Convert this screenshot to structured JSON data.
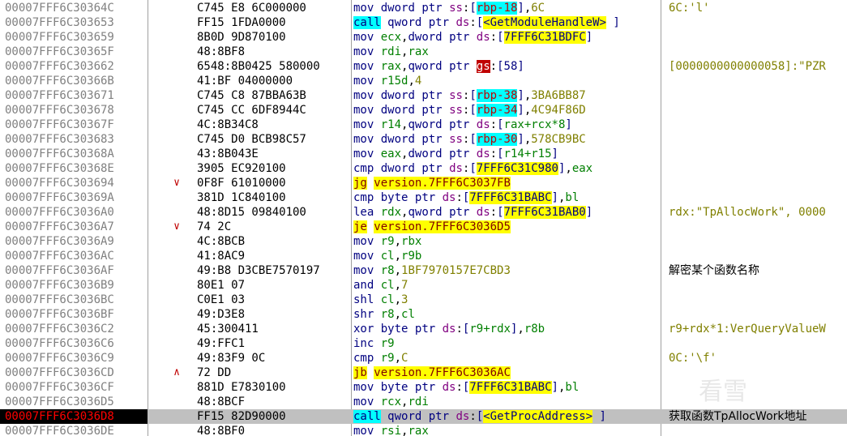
{
  "rows": [
    {
      "addr": "00007FFF6C30364C",
      "arrow": "",
      "bytes": "C745 E8 6C000000",
      "tokens": [
        [
          "mov",
          "mn"
        ],
        [
          " ",
          ""
        ],
        [
          "dword",
          "kw"
        ],
        [
          " ",
          ""
        ],
        [
          "ptr",
          "kw"
        ],
        [
          " ",
          ""
        ],
        [
          "ss",
          "seg"
        ],
        [
          ":",
          ""
        ],
        [
          "[",
          "plain"
        ],
        [
          "rbp-18",
          "rbp"
        ],
        [
          "]",
          "plain"
        ],
        [
          ",",
          ""
        ],
        [
          "6C",
          "num"
        ]
      ],
      "comment": "6C:'l'",
      "ctype": "gray"
    },
    {
      "addr": "00007FFF6C303653",
      "arrow": "",
      "bytes": "FF15 1FDA0000",
      "tokens": [
        [
          "call",
          "call"
        ],
        [
          " ",
          ""
        ],
        [
          "qword",
          "kw"
        ],
        [
          " ",
          ""
        ],
        [
          "ptr",
          "kw"
        ],
        [
          " ",
          ""
        ],
        [
          "ds",
          "seg"
        ],
        [
          ":",
          ""
        ],
        [
          "[",
          "plain"
        ],
        [
          "<GetModuleHandleW>",
          "mem"
        ],
        [
          " ]",
          "plain"
        ]
      ],
      "comment": "",
      "ctype": ""
    },
    {
      "addr": "00007FFF6C303659",
      "arrow": "",
      "bytes": "8B0D 9D870100",
      "tokens": [
        [
          "mov",
          "mn"
        ],
        [
          " ",
          ""
        ],
        [
          "ecx",
          "reg"
        ],
        [
          ",",
          ""
        ],
        [
          "dword",
          "kw"
        ],
        [
          " ",
          ""
        ],
        [
          "ptr",
          "kw"
        ],
        [
          " ",
          ""
        ],
        [
          "ds",
          "seg"
        ],
        [
          ":",
          ""
        ],
        [
          "[",
          "plain"
        ],
        [
          "7FFF6C31BDFC",
          "mem"
        ],
        [
          "]",
          "plain"
        ]
      ],
      "comment": "",
      "ctype": ""
    },
    {
      "addr": "00007FFF6C30365F",
      "arrow": "",
      "bytes": "48:8BF8",
      "tokens": [
        [
          "mov",
          "mn"
        ],
        [
          " ",
          ""
        ],
        [
          "rdi",
          "reg"
        ],
        [
          ",",
          ""
        ],
        [
          "rax",
          "reg"
        ]
      ],
      "comment": "",
      "ctype": ""
    },
    {
      "addr": "00007FFF6C303662",
      "arrow": "",
      "bytes": "6548:8B0425 580000",
      "tokens": [
        [
          "mov",
          "mn"
        ],
        [
          " ",
          ""
        ],
        [
          "rax",
          "reg"
        ],
        [
          ",",
          ""
        ],
        [
          "qword",
          "kw"
        ],
        [
          " ",
          ""
        ],
        [
          "ptr",
          "kw"
        ],
        [
          " ",
          ""
        ],
        [
          "gs",
          "gs"
        ],
        [
          ":",
          ""
        ],
        [
          "[58]",
          "plain"
        ]
      ],
      "comment": "[0000000000000058]:\"PZR",
      "ctype": "gray"
    },
    {
      "addr": "00007FFF6C30366B",
      "arrow": "",
      "bytes": "41:BF 04000000",
      "tokens": [
        [
          "mov",
          "mn"
        ],
        [
          " ",
          ""
        ],
        [
          "r15d",
          "reg"
        ],
        [
          ",",
          ""
        ],
        [
          "4",
          "num"
        ]
      ],
      "comment": "",
      "ctype": ""
    },
    {
      "addr": "00007FFF6C303671",
      "arrow": "",
      "bytes": "C745 C8 87BBA63B",
      "tokens": [
        [
          "mov",
          "mn"
        ],
        [
          " ",
          ""
        ],
        [
          "dword",
          "kw"
        ],
        [
          " ",
          ""
        ],
        [
          "ptr",
          "kw"
        ],
        [
          " ",
          ""
        ],
        [
          "ss",
          "seg"
        ],
        [
          ":",
          ""
        ],
        [
          "[",
          "plain"
        ],
        [
          "rbp-38",
          "rbp"
        ],
        [
          "]",
          "plain"
        ],
        [
          ",",
          ""
        ],
        [
          "3BA6BB87",
          "num"
        ]
      ],
      "comment": "",
      "ctype": ""
    },
    {
      "addr": "00007FFF6C303678",
      "arrow": "",
      "bytes": "C745 CC 6DF8944C",
      "tokens": [
        [
          "mov",
          "mn"
        ],
        [
          " ",
          ""
        ],
        [
          "dword",
          "kw"
        ],
        [
          " ",
          ""
        ],
        [
          "ptr",
          "kw"
        ],
        [
          " ",
          ""
        ],
        [
          "ss",
          "seg"
        ],
        [
          ":",
          ""
        ],
        [
          "[",
          "plain"
        ],
        [
          "rbp-34",
          "rbp"
        ],
        [
          "]",
          "plain"
        ],
        [
          ",",
          ""
        ],
        [
          "4C94F86D",
          "num"
        ]
      ],
      "comment": "",
      "ctype": ""
    },
    {
      "addr": "00007FFF6C30367F",
      "arrow": "",
      "bytes": "4C:8B34C8",
      "tokens": [
        [
          "mov",
          "mn"
        ],
        [
          " ",
          ""
        ],
        [
          "r14",
          "reg"
        ],
        [
          ",",
          ""
        ],
        [
          "qword",
          "kw"
        ],
        [
          " ",
          ""
        ],
        [
          "ptr",
          "kw"
        ],
        [
          " ",
          ""
        ],
        [
          "ds",
          "seg"
        ],
        [
          ":",
          ""
        ],
        [
          "[",
          "plain"
        ],
        [
          "rax+rcx*8",
          "reg"
        ],
        [
          "]",
          "plain"
        ]
      ],
      "comment": "",
      "ctype": ""
    },
    {
      "addr": "00007FFF6C303683",
      "arrow": "",
      "bytes": "C745 D0 BCB98C57",
      "tokens": [
        [
          "mov",
          "mn"
        ],
        [
          " ",
          ""
        ],
        [
          "dword",
          "kw"
        ],
        [
          " ",
          ""
        ],
        [
          "ptr",
          "kw"
        ],
        [
          " ",
          ""
        ],
        [
          "ss",
          "seg"
        ],
        [
          ":",
          ""
        ],
        [
          "[",
          "plain"
        ],
        [
          "rbp-30",
          "rbp"
        ],
        [
          "]",
          "plain"
        ],
        [
          ",",
          ""
        ],
        [
          "578CB9BC",
          "num"
        ]
      ],
      "comment": "",
      "ctype": ""
    },
    {
      "addr": "00007FFF6C30368A",
      "arrow": "",
      "bytes": "43:8B043E",
      "tokens": [
        [
          "mov",
          "mn"
        ],
        [
          " ",
          ""
        ],
        [
          "eax",
          "reg"
        ],
        [
          ",",
          ""
        ],
        [
          "dword",
          "kw"
        ],
        [
          " ",
          ""
        ],
        [
          "ptr",
          "kw"
        ],
        [
          " ",
          ""
        ],
        [
          "ds",
          "seg"
        ],
        [
          ":",
          ""
        ],
        [
          "[",
          "plain"
        ],
        [
          "r14+r15",
          "reg"
        ],
        [
          "]",
          "plain"
        ]
      ],
      "comment": "",
      "ctype": ""
    },
    {
      "addr": "00007FFF6C30368E",
      "arrow": "",
      "bytes": "3905 EC920100",
      "tokens": [
        [
          "cmp",
          "mn"
        ],
        [
          " ",
          ""
        ],
        [
          "dword",
          "kw"
        ],
        [
          " ",
          ""
        ],
        [
          "ptr",
          "kw"
        ],
        [
          " ",
          ""
        ],
        [
          "ds",
          "seg"
        ],
        [
          ":",
          ""
        ],
        [
          "[",
          "plain"
        ],
        [
          "7FFF6C31C980",
          "mem"
        ],
        [
          "]",
          "plain"
        ],
        [
          ",",
          ""
        ],
        [
          "eax",
          "reg"
        ]
      ],
      "comment": "",
      "ctype": ""
    },
    {
      "addr": "00007FFF6C303694",
      "arrow": "down",
      "bytes": "0F8F 61010000",
      "tokens": [
        [
          "jg",
          "jmp"
        ],
        [
          " ",
          ""
        ],
        [
          "version.7FFF6C3037FB",
          "jmp"
        ]
      ],
      "comment": "",
      "ctype": ""
    },
    {
      "addr": "00007FFF6C30369A",
      "arrow": "",
      "bytes": "381D 1C840100",
      "tokens": [
        [
          "cmp",
          "mn"
        ],
        [
          " ",
          ""
        ],
        [
          "byte",
          "kw"
        ],
        [
          " ",
          ""
        ],
        [
          "ptr",
          "kw"
        ],
        [
          " ",
          ""
        ],
        [
          "ds",
          "seg"
        ],
        [
          ":",
          ""
        ],
        [
          "[",
          "plain"
        ],
        [
          "7FFF6C31BABC",
          "mem"
        ],
        [
          "]",
          "plain"
        ],
        [
          ",",
          ""
        ],
        [
          "bl",
          "reg"
        ]
      ],
      "comment": "",
      "ctype": ""
    },
    {
      "addr": "00007FFF6C3036A0",
      "arrow": "",
      "bytes": "48:8D15 09840100",
      "tokens": [
        [
          "lea",
          "mn"
        ],
        [
          " ",
          ""
        ],
        [
          "rdx",
          "reg"
        ],
        [
          ",",
          ""
        ],
        [
          "qword",
          "kw"
        ],
        [
          " ",
          ""
        ],
        [
          "ptr",
          "kw"
        ],
        [
          " ",
          ""
        ],
        [
          "ds",
          "seg"
        ],
        [
          ":",
          ""
        ],
        [
          "[",
          "plain"
        ],
        [
          "7FFF6C31BAB0",
          "mem"
        ],
        [
          "]",
          "plain"
        ]
      ],
      "comment": "rdx:\"TpAllocWork\", 0000",
      "ctype": "gray"
    },
    {
      "addr": "00007FFF6C3036A7",
      "arrow": "down",
      "bytes": "74 2C",
      "tokens": [
        [
          "je",
          "jmp"
        ],
        [
          " ",
          ""
        ],
        [
          "version.7FFF6C3036D5",
          "jmp"
        ]
      ],
      "comment": "",
      "ctype": ""
    },
    {
      "addr": "00007FFF6C3036A9",
      "arrow": "",
      "bytes": "4C:8BCB",
      "tokens": [
        [
          "mov",
          "mn"
        ],
        [
          " ",
          ""
        ],
        [
          "r9",
          "reg"
        ],
        [
          ",",
          ""
        ],
        [
          "rbx",
          "reg"
        ]
      ],
      "comment": "",
      "ctype": ""
    },
    {
      "addr": "00007FFF6C3036AC",
      "arrow": "",
      "bytes": "41:8AC9",
      "tokens": [
        [
          "mov",
          "mn"
        ],
        [
          " ",
          ""
        ],
        [
          "cl",
          "reg"
        ],
        [
          ",",
          ""
        ],
        [
          "r9b",
          "reg"
        ]
      ],
      "comment": "",
      "ctype": ""
    },
    {
      "addr": "00007FFF6C3036AF",
      "arrow": "",
      "bytes": "49:B8 D3CBE7570197",
      "tokens": [
        [
          "mov",
          "mn"
        ],
        [
          " ",
          ""
        ],
        [
          "r8",
          "reg"
        ],
        [
          ",",
          ""
        ],
        [
          "1BF7970157E7CBD3",
          "num"
        ]
      ],
      "comment": "解密某个函数名称",
      "ctype": "black"
    },
    {
      "addr": "00007FFF6C3036B9",
      "arrow": "",
      "bytes": "80E1 07",
      "tokens": [
        [
          "and",
          "mn"
        ],
        [
          " ",
          ""
        ],
        [
          "cl",
          "reg"
        ],
        [
          ",",
          ""
        ],
        [
          "7",
          "num"
        ]
      ],
      "comment": "",
      "ctype": ""
    },
    {
      "addr": "00007FFF6C3036BC",
      "arrow": "",
      "bytes": "C0E1 03",
      "tokens": [
        [
          "shl",
          "mn"
        ],
        [
          " ",
          ""
        ],
        [
          "cl",
          "reg"
        ],
        [
          ",",
          ""
        ],
        [
          "3",
          "num"
        ]
      ],
      "comment": "",
      "ctype": ""
    },
    {
      "addr": "00007FFF6C3036BF",
      "arrow": "",
      "bytes": "49:D3E8",
      "tokens": [
        [
          "shr",
          "mn"
        ],
        [
          " ",
          ""
        ],
        [
          "r8",
          "reg"
        ],
        [
          ",",
          ""
        ],
        [
          "cl",
          "reg"
        ]
      ],
      "comment": "",
      "ctype": ""
    },
    {
      "addr": "00007FFF6C3036C2",
      "arrow": "",
      "bytes": "45:300411",
      "tokens": [
        [
          "xor",
          "mn"
        ],
        [
          " ",
          ""
        ],
        [
          "byte",
          "kw"
        ],
        [
          " ",
          ""
        ],
        [
          "ptr",
          "kw"
        ],
        [
          " ",
          ""
        ],
        [
          "ds",
          "seg"
        ],
        [
          ":",
          ""
        ],
        [
          "[",
          "plain"
        ],
        [
          "r9+rdx",
          "reg"
        ],
        [
          "]",
          "plain"
        ],
        [
          ",",
          ""
        ],
        [
          "r8b",
          "reg"
        ]
      ],
      "comment": "r9+rdx*1:VerQueryValueW",
      "ctype": "gray"
    },
    {
      "addr": "00007FFF6C3036C6",
      "arrow": "",
      "bytes": "49:FFC1",
      "tokens": [
        [
          "inc",
          "mn"
        ],
        [
          " ",
          ""
        ],
        [
          "r9",
          "reg"
        ]
      ],
      "comment": "",
      "ctype": ""
    },
    {
      "addr": "00007FFF6C3036C9",
      "arrow": "",
      "bytes": "49:83F9 0C",
      "tokens": [
        [
          "cmp",
          "mn"
        ],
        [
          " ",
          ""
        ],
        [
          "r9",
          "reg"
        ],
        [
          ",",
          ""
        ],
        [
          "C",
          "num"
        ]
      ],
      "comment": "0C:'\\f'",
      "ctype": "gray"
    },
    {
      "addr": "00007FFF6C3036CD",
      "arrow": "up",
      "bytes": "72 DD",
      "tokens": [
        [
          "jb",
          "jmp"
        ],
        [
          " ",
          ""
        ],
        [
          "version.7FFF6C3036AC",
          "jmp"
        ]
      ],
      "comment": "",
      "ctype": ""
    },
    {
      "addr": "00007FFF6C3036CF",
      "arrow": "",
      "bytes": "881D E7830100",
      "tokens": [
        [
          "mov",
          "mn"
        ],
        [
          " ",
          ""
        ],
        [
          "byte",
          "kw"
        ],
        [
          " ",
          ""
        ],
        [
          "ptr",
          "kw"
        ],
        [
          " ",
          ""
        ],
        [
          "ds",
          "seg"
        ],
        [
          ":",
          ""
        ],
        [
          "[",
          "plain"
        ],
        [
          "7FFF6C31BABC",
          "mem"
        ],
        [
          "]",
          "plain"
        ],
        [
          ",",
          ""
        ],
        [
          "bl",
          "reg"
        ]
      ],
      "comment": "",
      "ctype": ""
    },
    {
      "addr": "00007FFF6C3036D5",
      "arrow": "",
      "bytes": "48:8BCF",
      "tokens": [
        [
          "mov",
          "mn"
        ],
        [
          " ",
          ""
        ],
        [
          "rcx",
          "reg"
        ],
        [
          ",",
          ""
        ],
        [
          "rdi",
          "reg"
        ]
      ],
      "comment": "",
      "ctype": ""
    },
    {
      "addr": "00007FFF6C3036D8",
      "arrow": "",
      "bytes": "FF15 82D90000",
      "tokens": [
        [
          "call",
          "call"
        ],
        [
          " ",
          ""
        ],
        [
          "qword",
          "kw"
        ],
        [
          " ",
          ""
        ],
        [
          "ptr",
          "kw"
        ],
        [
          " ",
          ""
        ],
        [
          "ds",
          "seg"
        ],
        [
          ":",
          ""
        ],
        [
          "[",
          "plain"
        ],
        [
          "<GetProcAddress>",
          "mem"
        ],
        [
          " ]",
          "plain"
        ]
      ],
      "comment": "获取函数TpAllocWork地址",
      "ctype": "black",
      "selected": true
    },
    {
      "addr": "00007FFF6C3036DE",
      "arrow": "",
      "bytes": "48:8BF0",
      "tokens": [
        [
          "mov",
          "mn"
        ],
        [
          " ",
          ""
        ],
        [
          "rsi",
          "reg"
        ],
        [
          ",",
          ""
        ],
        [
          "rax",
          "reg"
        ]
      ],
      "comment": "",
      "ctype": ""
    }
  ],
  "watermark": "看雪",
  "colors": {
    "selected_row": "#c0c0c0",
    "current_addr_bg": "#000000",
    "current_addr_fg": "#ff0000"
  }
}
